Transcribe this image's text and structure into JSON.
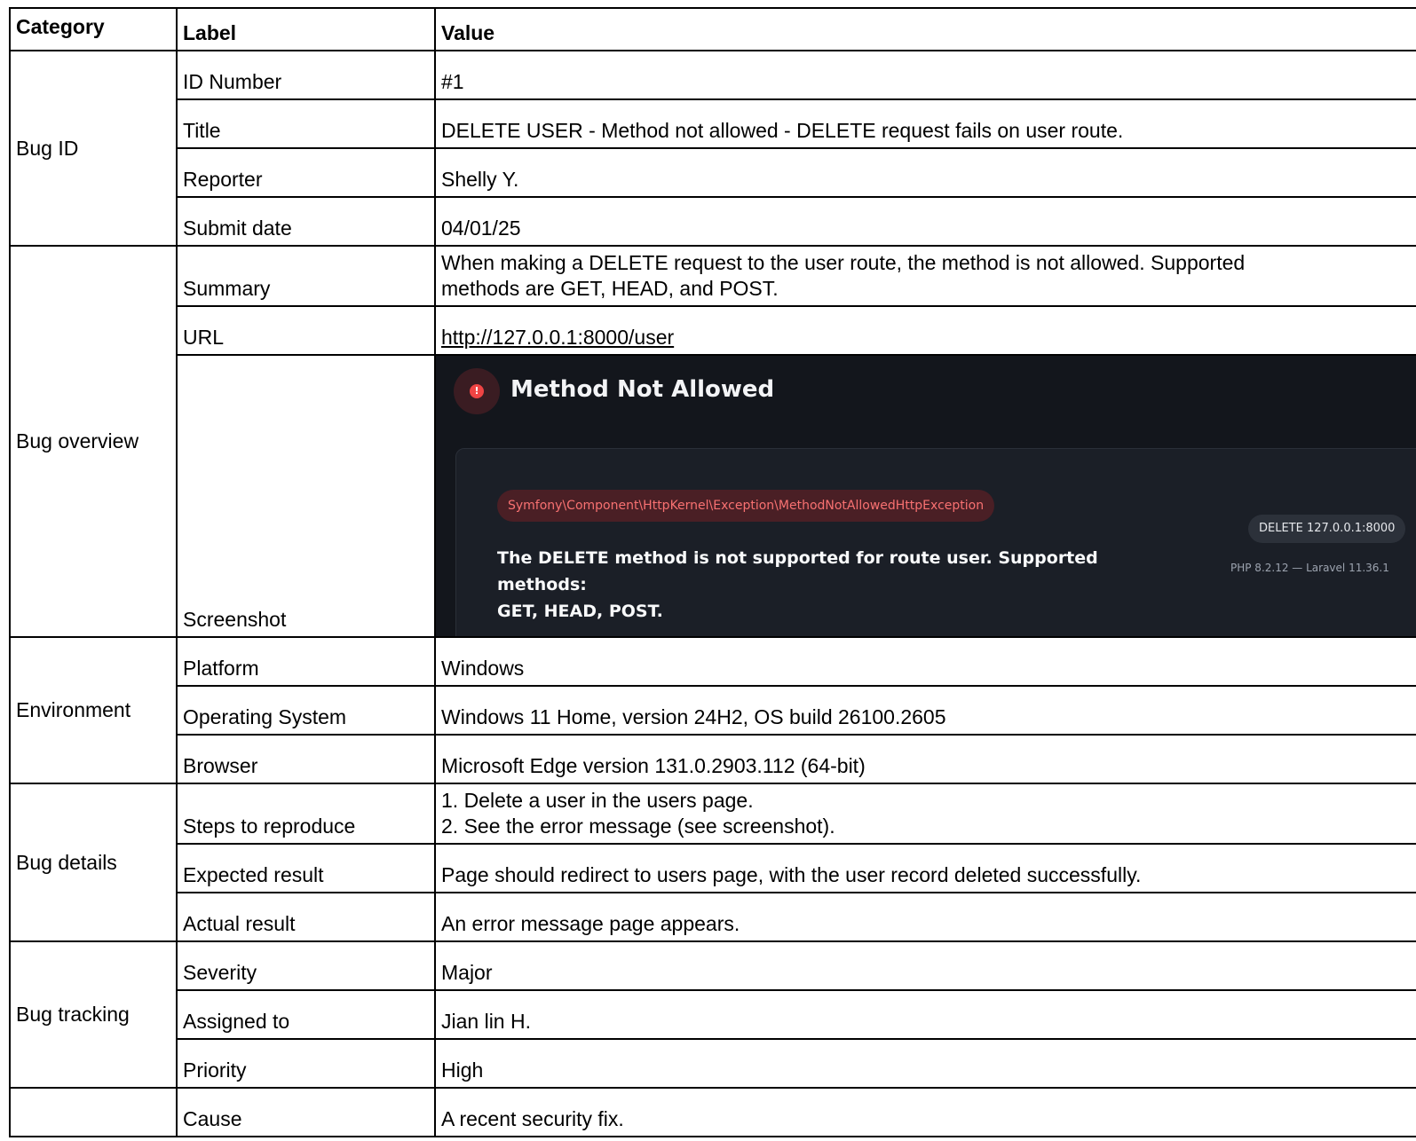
{
  "headers": {
    "category": "Category",
    "label": "Label",
    "value": "Value"
  },
  "bug_id": {
    "category": "Bug ID",
    "rows": [
      {
        "label": "ID Number",
        "value": "#1"
      },
      {
        "label": "Title",
        "value": "DELETE USER - Method not allowed - DELETE request fails on user route."
      },
      {
        "label": "Reporter",
        "value": "Shelly Y."
      },
      {
        "label": "Submit date",
        "value": "04/01/25"
      }
    ]
  },
  "bug_overview": {
    "category": "Bug overview",
    "summary": {
      "label": "Summary",
      "value_line1": "When making a DELETE request to the user route, the method is not allowed. Supported",
      "value_line2": "methods are GET, HEAD, and POST."
    },
    "url": {
      "label": "URL",
      "value": "http://127.0.0.1:8000/user"
    },
    "screenshot": {
      "label": "Screenshot",
      "title": "Method Not Allowed",
      "exception": "Symfony\\Component\\HttpKernel\\Exception\\MethodNotAllowedHttpException",
      "message_line1": "The DELETE method is not supported for route user. Supported methods:",
      "message_line2": "GET, HEAD, POST.",
      "request": "DELETE 127.0.0.1:8000",
      "versions": "PHP 8.2.12 — Laravel 11.36.1"
    }
  },
  "environment": {
    "category": "Environment",
    "rows": [
      {
        "label": "Platform",
        "value": "Windows"
      },
      {
        "label": "Operating System",
        "value": "Windows 11 Home, version 24H2, OS build 26100.2605"
      },
      {
        "label": "Browser",
        "value": "Microsoft Edge version 131.0.2903.112 (64-bit)"
      }
    ]
  },
  "bug_details": {
    "category": "Bug details",
    "steps": {
      "label": "Steps to reproduce",
      "step1": "1. Delete a user in the users page.",
      "step2": "2. See the error message (see screenshot)."
    },
    "rows": [
      {
        "label": "Expected result",
        "value": "Page should redirect to users page, with the user record deleted successfully."
      },
      {
        "label": "Actual result",
        "value": "An error message page appears."
      }
    ]
  },
  "bug_tracking": {
    "category": "Bug tracking",
    "rows": [
      {
        "label": "Severity",
        "value": "Major"
      },
      {
        "label": "Assigned to",
        "value": "Jian lin H."
      },
      {
        "label": "Priority",
        "value": "High"
      }
    ]
  },
  "last_section": {
    "rows": [
      {
        "label": "Cause",
        "value": "A recent security fix."
      }
    ]
  },
  "colors": {
    "border": "#000000",
    "screenshot_bg": "#13161c",
    "error_red": "#ef4444"
  }
}
